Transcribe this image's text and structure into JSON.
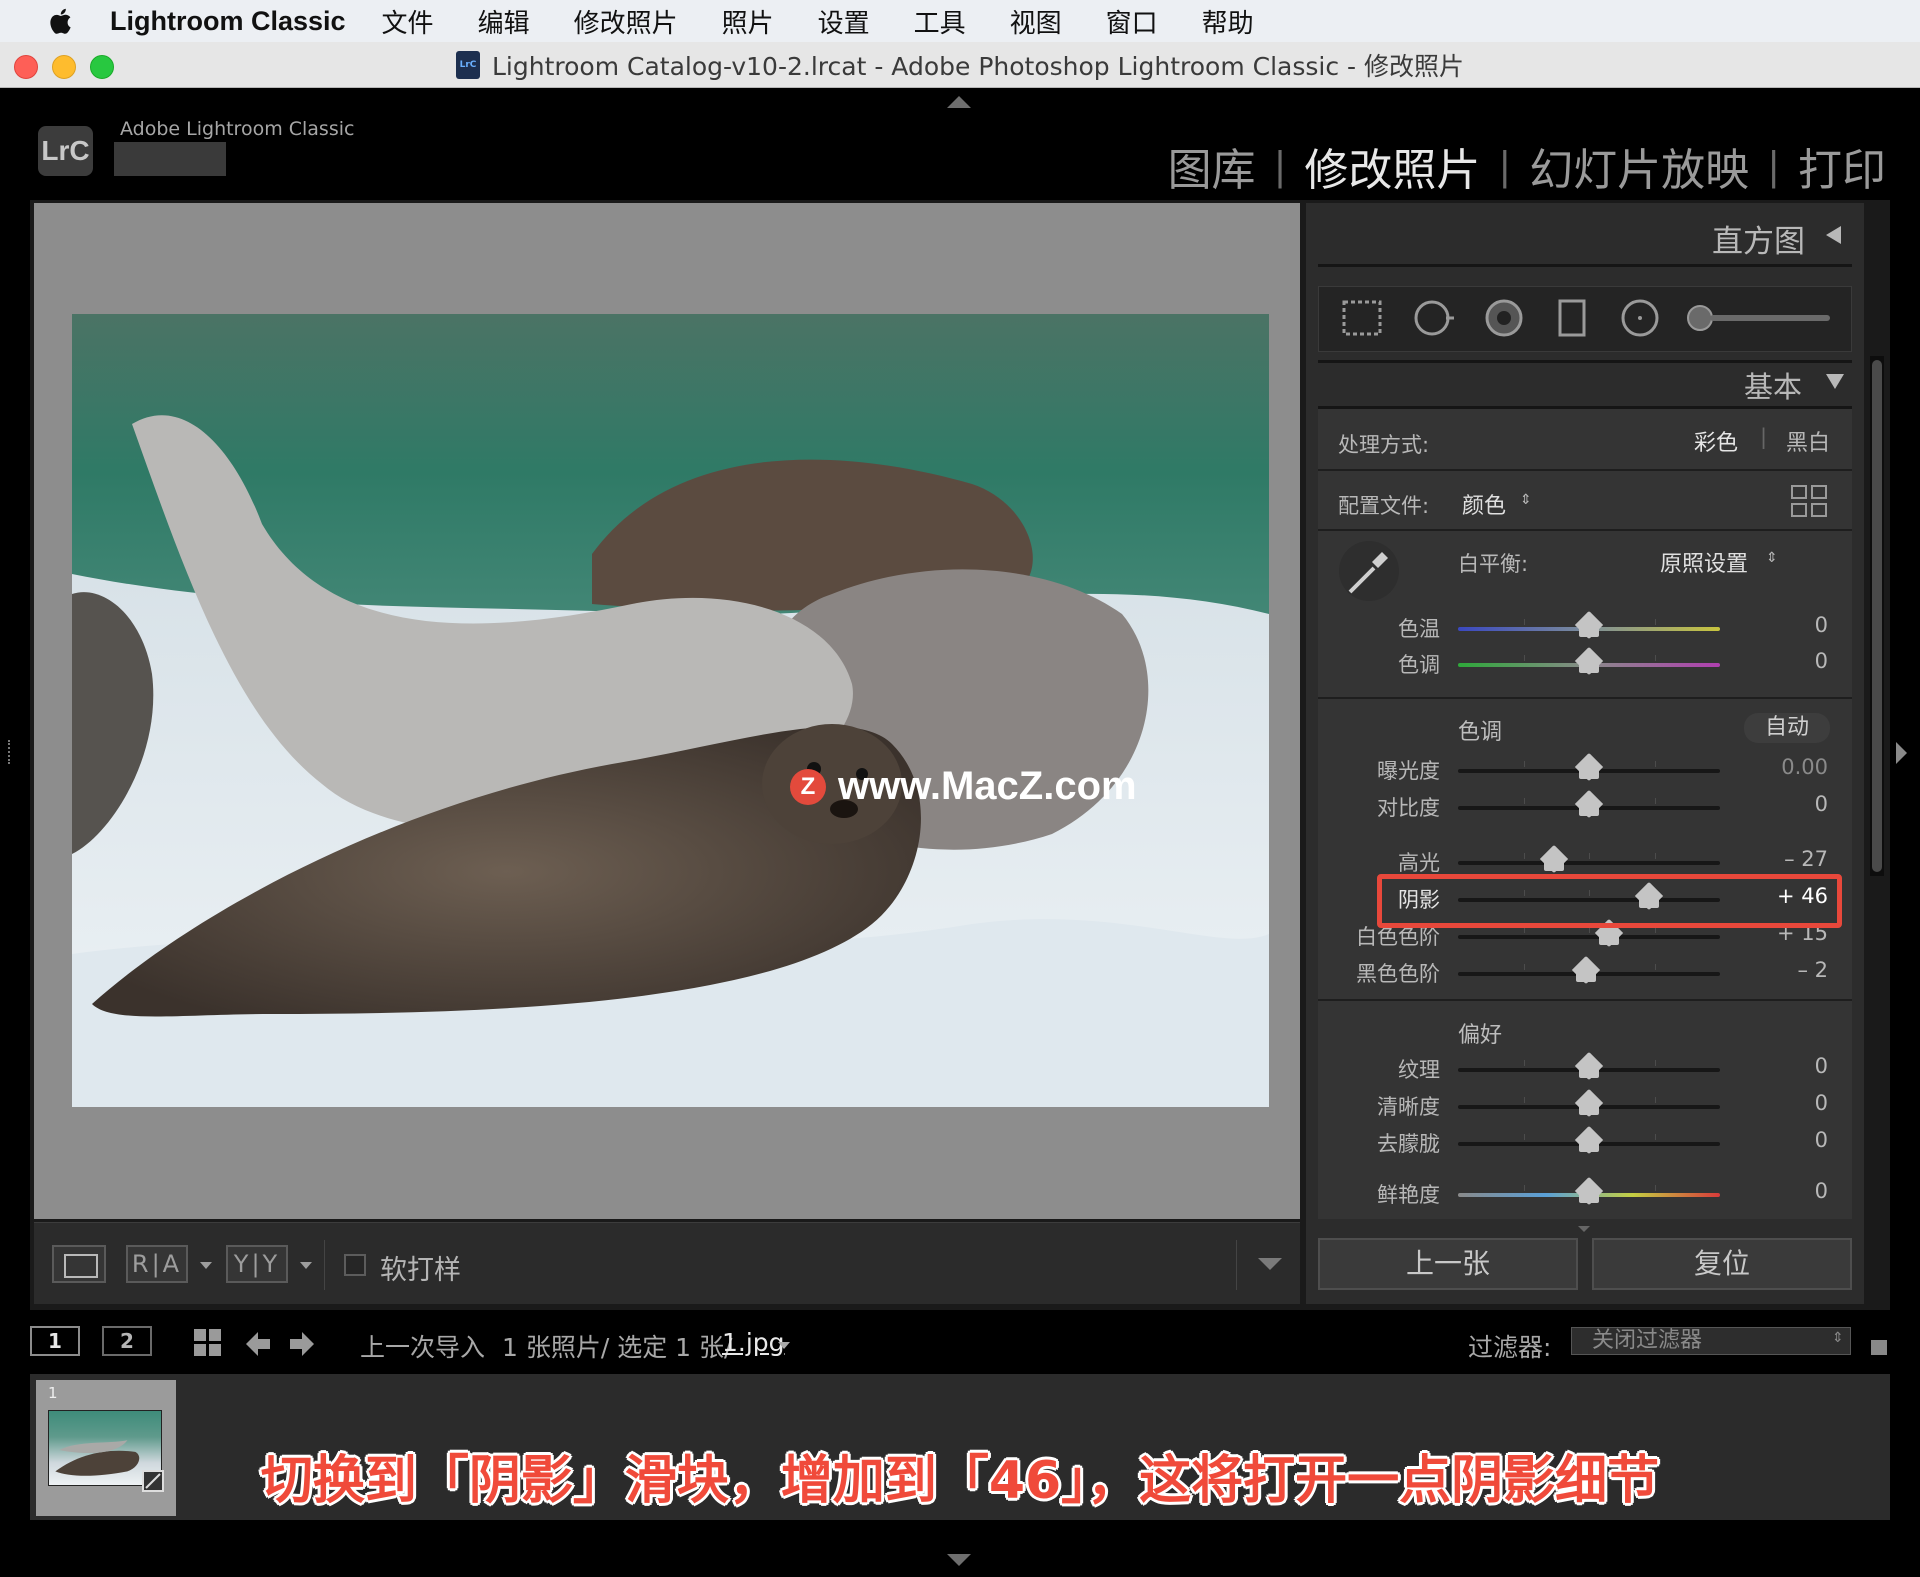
{
  "menubar": {
    "app_name": "Lightroom Classic",
    "menus": [
      "文件",
      "编辑",
      "修改照片",
      "照片",
      "设置",
      "工具",
      "视图",
      "窗口",
      "帮助"
    ]
  },
  "window": {
    "title": "Lightroom Catalog-v10-2.lrcat - Adobe Photoshop Lightroom Classic - 修改照片",
    "doc_icon": "LrC"
  },
  "identity": {
    "logo": "LrC",
    "name": "Adobe Lightroom Classic"
  },
  "modules": [
    {
      "label": "图库",
      "active": false
    },
    {
      "label": "修改照片",
      "active": true
    },
    {
      "label": "幻灯片放映",
      "active": false
    },
    {
      "label": "打印",
      "active": false
    }
  ],
  "watermark": {
    "logo": "Z",
    "text": "www.MacZ.com"
  },
  "toolbar": {
    "ra_label": "R|A",
    "yy_label": "Y|Y",
    "softproof_label": "软打样"
  },
  "panel": {
    "histogram_title": "直方图",
    "basic_title": "基本",
    "treatment_label": "处理方式:",
    "treatment_color": "彩色",
    "treatment_bw": "黑白",
    "profile_label": "配置文件:",
    "profile_value": "颜色",
    "wb_label": "白平衡:",
    "wb_value": "原照设置",
    "tone_title": "色调",
    "auto_label": "自动",
    "presence_title": "偏好",
    "sliders": [
      {
        "key": "temp",
        "label": "色温",
        "value": "0",
        "pos": 0.5
      },
      {
        "key": "tint",
        "label": "色调",
        "value": "0",
        "pos": 0.5
      },
      {
        "key": "exposure",
        "label": "曝光度",
        "value": "0.00",
        "pos": 0.5
      },
      {
        "key": "contrast",
        "label": "对比度",
        "value": "0",
        "pos": 0.5
      },
      {
        "key": "highlights",
        "label": "高光",
        "value": "– 27",
        "pos": 0.365
      },
      {
        "key": "shadows",
        "label": "阴影",
        "value": "+ 46",
        "pos": 0.73
      },
      {
        "key": "whites",
        "label": "白色色阶",
        "value": "+ 15",
        "pos": 0.575
      },
      {
        "key": "blacks",
        "label": "黑色色阶",
        "value": "– 2",
        "pos": 0.49
      },
      {
        "key": "texture",
        "label": "纹理",
        "value": "0",
        "pos": 0.5
      },
      {
        "key": "clarity",
        "label": "清晰度",
        "value": "0",
        "pos": 0.5
      },
      {
        "key": "dehaze",
        "label": "去朦胧",
        "value": "0",
        "pos": 0.5
      },
      {
        "key": "vibrance",
        "label": "鲜艳度",
        "value": "0",
        "pos": 0.5
      }
    ],
    "prev_button": "上一张",
    "reset_button": "复位"
  },
  "filmstrip": {
    "monitor1": "1",
    "monitor2": "2",
    "source": "上一次导入",
    "count": "1 张照片/ 选定 1 张/",
    "filename": "1.jpg",
    "filter_label": "过滤器:",
    "filter_value": "关闭过滤器",
    "thumb_index": "1"
  },
  "caption": "切换到「阴影」滑块，增加到「46」，这将打开一点阴影细节",
  "colors": {
    "accent_highlight": "#e8483b",
    "caption": "#f04a3a"
  }
}
